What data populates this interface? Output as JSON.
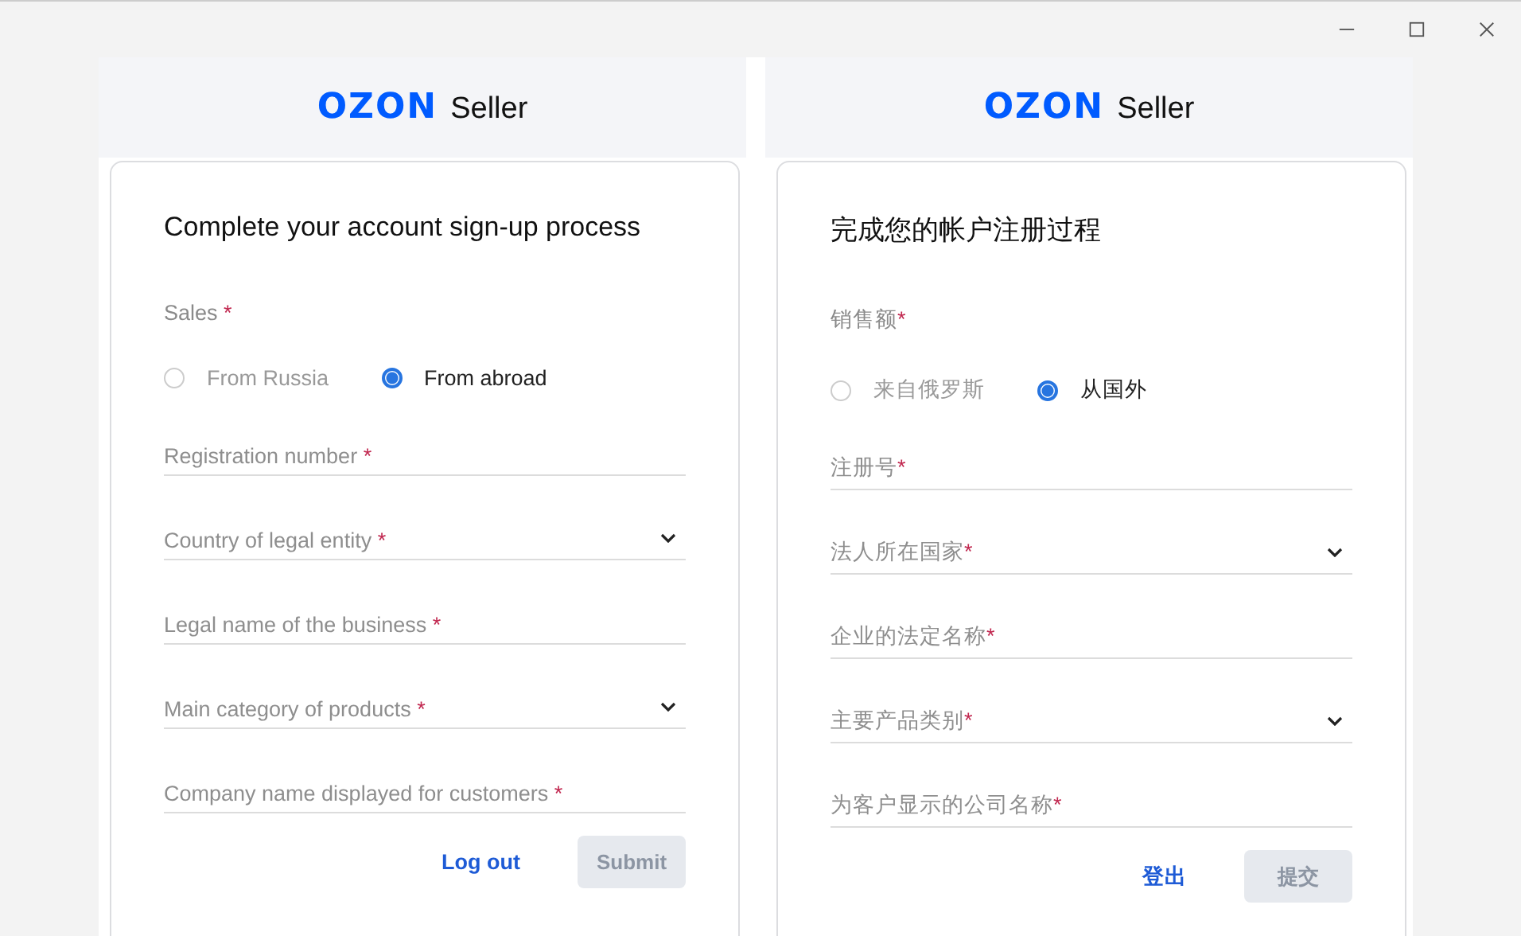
{
  "panels": [
    {
      "logo": {
        "brand": "OZON",
        "product": "Seller"
      },
      "title": "Complete your account sign-up process",
      "sales": {
        "label": "Sales",
        "required_mark": " *",
        "options": [
          {
            "label": "From Russia",
            "selected": false
          },
          {
            "label": "From abroad",
            "selected": true
          }
        ]
      },
      "fields": [
        {
          "kind": "input",
          "placeholder": "Registration number",
          "required_mark": " *"
        },
        {
          "kind": "select",
          "placeholder": "Country of legal entity",
          "required_mark": " *"
        },
        {
          "kind": "input",
          "placeholder": "Legal name of the business",
          "required_mark": " *"
        },
        {
          "kind": "select",
          "placeholder": "Main category of products",
          "required_mark": " *"
        },
        {
          "kind": "input",
          "placeholder": "Company name displayed for customers",
          "required_mark": " *"
        }
      ],
      "logout": "Log out",
      "submit": {
        "label": "Submit",
        "disabled": true
      }
    },
    {
      "logo": {
        "brand": "OZON",
        "product": "Seller"
      },
      "title": "完成您的帐户注册过程",
      "sales": {
        "label": "销售额",
        "required_mark": "*",
        "options": [
          {
            "label": "来自俄罗斯",
            "selected": false
          },
          {
            "label": "从国外",
            "selected": true
          }
        ]
      },
      "fields": [
        {
          "kind": "input",
          "placeholder": "注册号",
          "required_mark": "*"
        },
        {
          "kind": "select",
          "placeholder": "法人所在国家",
          "required_mark": "*"
        },
        {
          "kind": "input",
          "placeholder": "企业的法定名称",
          "required_mark": "*"
        },
        {
          "kind": "select",
          "placeholder": "主要产品类别",
          "required_mark": "*"
        },
        {
          "kind": "input",
          "placeholder": "为客户显示的公司名称",
          "required_mark": "*"
        }
      ],
      "logout": "登出",
      "submit": {
        "label": "提交",
        "disabled": true
      }
    }
  ]
}
